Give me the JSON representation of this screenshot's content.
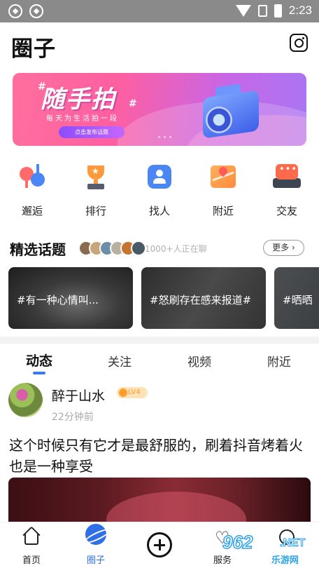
{
  "status_bar": {
    "time": "2:23"
  },
  "header": {
    "title": "圈子",
    "camera_icon": "camera-icon"
  },
  "banner": {
    "title": "随手拍",
    "hash": "#",
    "subtitle": "每天为生活拍一段",
    "button_label": "点击发布话题"
  },
  "categories": [
    {
      "label": "邂逅",
      "icon": "gender-icon"
    },
    {
      "label": "排行",
      "icon": "trophy-icon"
    },
    {
      "label": "找人",
      "icon": "person-card-icon"
    },
    {
      "label": "附近",
      "icon": "map-pin-icon"
    },
    {
      "label": "交友",
      "icon": "chat-icon"
    }
  ],
  "topics_section": {
    "title": "精选话题",
    "online_text": "1000+人正在聊",
    "more_label": "更多"
  },
  "topics": [
    {
      "label": "#有一种心情叫..."
    },
    {
      "label": "#怒刷存在感来报道#"
    },
    {
      "label": "#晒晒"
    }
  ],
  "feed_tabs": [
    {
      "label": "动态",
      "active": true
    },
    {
      "label": "关注",
      "active": false
    },
    {
      "label": "视频",
      "active": false
    },
    {
      "label": "附近",
      "active": false
    }
  ],
  "post": {
    "author": "醉于山水",
    "level": "LV4",
    "time": "22分钟前",
    "content": "这个时候只有它才是最舒服的，刷着抖音烤着火也是一种享受"
  },
  "bottom_nav": [
    {
      "label": "首页",
      "icon": "home-icon",
      "active": false
    },
    {
      "label": "圈子",
      "icon": "planet-icon",
      "active": true
    },
    {
      "label": "",
      "icon": "plus-icon",
      "active": false
    },
    {
      "label": "服务",
      "icon": "heart-icon",
      "active": false
    },
    {
      "label": "",
      "icon": "message-icon",
      "active": false
    }
  ],
  "watermark": {
    "number": "962",
    "suffix": ".NET",
    "text": "乐游网"
  },
  "colors": {
    "accent": "#3b7af0",
    "level_badge": "#ff9d2e"
  }
}
